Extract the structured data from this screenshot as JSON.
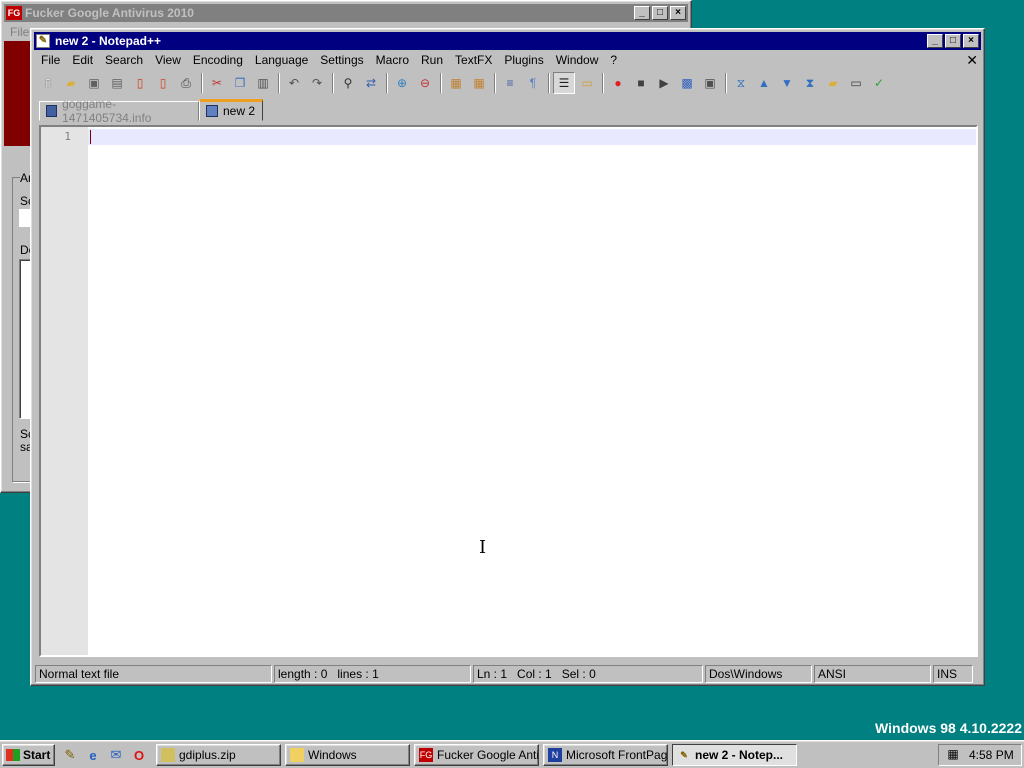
{
  "background_window": {
    "title": "Fucker Google Antivirus 2010",
    "app_icon": "FG",
    "menu_file": "File",
    "partial_labels": [
      "An",
      "Sc",
      "De",
      "Sc",
      "sa"
    ]
  },
  "notepad": {
    "title": "new  2 - Notepad++",
    "menu": [
      "File",
      "Edit",
      "Search",
      "View",
      "Encoding",
      "Language",
      "Settings",
      "Macro",
      "Run",
      "TextFX",
      "Plugins",
      "Window",
      "?"
    ],
    "close_doc": "✕",
    "toolbar_icons": [
      "new-file-icon",
      "open-file-icon",
      "save-icon",
      "save-all-icon",
      "close-icon",
      "close-all-icon",
      "print-icon",
      "cut-icon",
      "copy-icon",
      "paste-icon",
      "undo-icon",
      "redo-icon",
      "find-icon",
      "replace-icon",
      "zoom-in-icon",
      "zoom-out-icon",
      "sync-vertical-icon",
      "sync-horizontal-icon",
      "word-wrap-icon",
      "show-all-chars-icon",
      "indent-guide-icon",
      "user-lang-icon",
      "record-macro-icon",
      "stop-record-icon",
      "play-macro-icon",
      "run-macro-multiple-icon",
      "save-macro-icon",
      "collapse-icon",
      "prev-bookmark-icon",
      "next-bookmark-icon",
      "expand-icon",
      "folder-icon",
      "console-icon",
      "spell-check-icon"
    ],
    "tabs": [
      {
        "label": "goggame-1471405734.info",
        "active": false
      },
      {
        "label": "new  2",
        "active": true
      }
    ],
    "line_number": "1",
    "status": {
      "file_type": "Normal text file",
      "length": "length : 0",
      "lines": "lines : 1",
      "ln": "Ln : 1",
      "col": "Col : 1",
      "sel": "Sel : 0",
      "eol": "Dos\\Windows",
      "encoding": "ANSI",
      "mode": "INS"
    }
  },
  "os_label": "Windows 98 4.10.2222",
  "taskbar": {
    "start": "Start",
    "tasks": [
      {
        "label": "gdiplus.zip",
        "active": false
      },
      {
        "label": "Windows",
        "active": false
      },
      {
        "label": "Fucker Google Anti...",
        "active": false
      },
      {
        "label": "Microsoft FrontPage",
        "active": false
      },
      {
        "label": "new  2 - Notep...",
        "active": true
      }
    ],
    "clock": "4:58 PM"
  },
  "colors": {
    "desktop": "#008080",
    "active_title": "#000080",
    "inactive_title": "#808080",
    "tab_accent": "#f0a020"
  }
}
